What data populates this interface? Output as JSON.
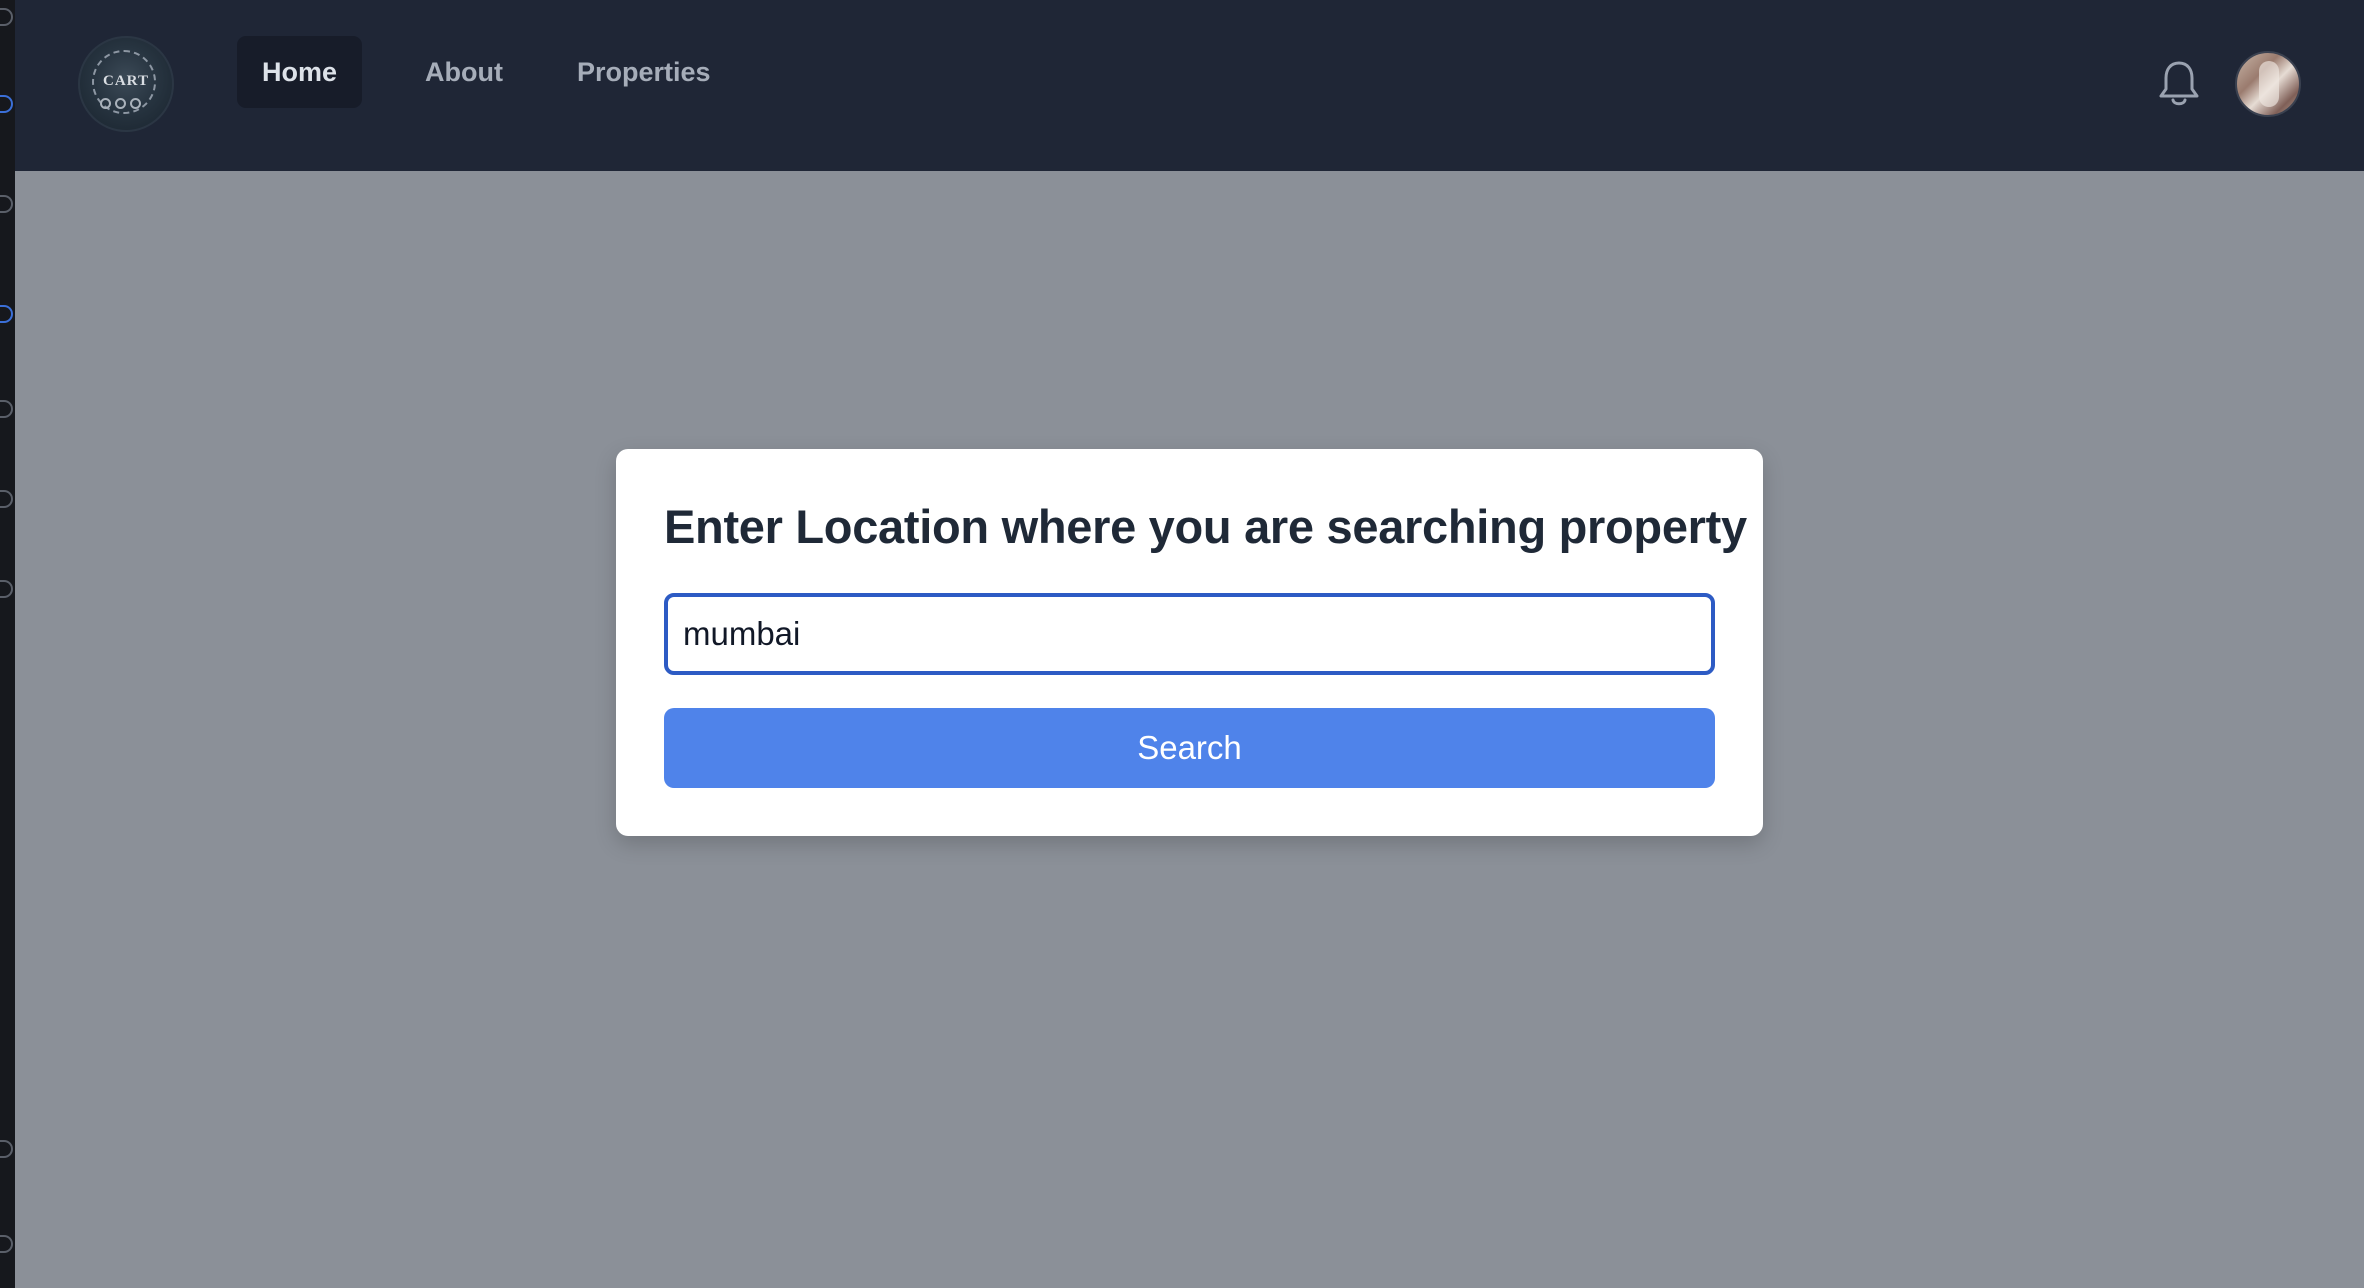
{
  "brand": {
    "logo_text": "CART",
    "icon": "cart-logo"
  },
  "nav": {
    "items": [
      {
        "label": "Home",
        "active": true
      },
      {
        "label": "About",
        "active": false
      },
      {
        "label": "Properties",
        "active": false
      }
    ],
    "notification_icon": "bell-icon",
    "avatar_icon": "user-avatar"
  },
  "search_card": {
    "title": "Enter Location where you are searching property",
    "input_value": "mumbai",
    "button_label": "Search"
  },
  "colors": {
    "navbar": "#1f2636",
    "page_background": "#8b9098",
    "card": "#ffffff",
    "accent": "#4f83ea",
    "input_border": "#2d5bc4",
    "active_nav": "#171c29"
  }
}
